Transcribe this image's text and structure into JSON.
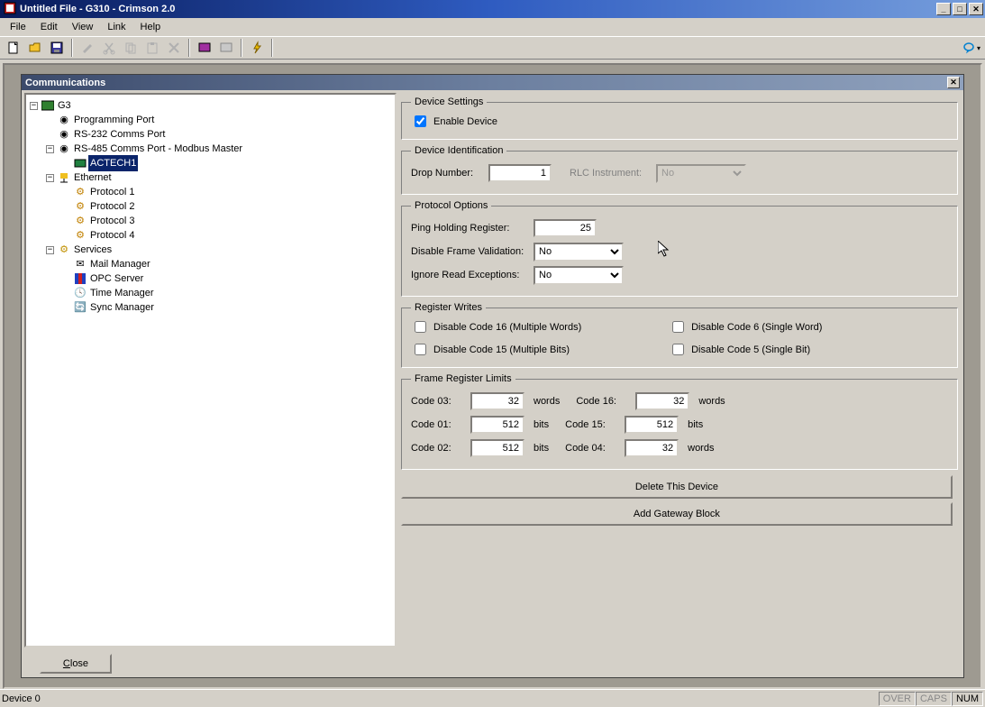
{
  "title": "Untitled File - G310 - Crimson 2.0",
  "menu": [
    "File",
    "Edit",
    "View",
    "Link",
    "Help"
  ],
  "panel_title": "Communications",
  "tree": {
    "root": "G3",
    "items": [
      "Programming Port",
      "RS-232 Comms Port",
      "RS-485 Comms Port - Modbus Master",
      "ACTECH1",
      "Ethernet",
      "Protocol 1",
      "Protocol 2",
      "Protocol 3",
      "Protocol 4",
      "Services",
      "Mail Manager",
      "OPC Server",
      "Time Manager",
      "Sync Manager"
    ]
  },
  "device_settings": {
    "legend": "Device Settings",
    "enable_label": "Enable Device",
    "enabled": true
  },
  "device_id": {
    "legend": "Device Identification",
    "drop_label": "Drop Number:",
    "drop_value": "1",
    "rlc_label": "RLC Instrument:",
    "rlc_value": "No"
  },
  "protocol_options": {
    "legend": "Protocol Options",
    "ping_label": "Ping Holding Register:",
    "ping_value": "25",
    "frame_val_label": "Disable Frame Validation:",
    "frame_val_value": "No",
    "ignore_label": "Ignore Read Exceptions:",
    "ignore_value": "No"
  },
  "register_writes": {
    "legend": "Register Writes",
    "c16": "Disable Code 16 (Multiple Words)",
    "c6": "Disable Code 6 (Single Word)",
    "c15": "Disable Code 15 (Multiple Bits)",
    "c5": "Disable Code 5 (Single Bit)"
  },
  "limits": {
    "legend": "Frame Register Limits",
    "code03_label": "Code 03:",
    "code03_value": "32",
    "code03_unit": "words",
    "code16_label": "Code 16:",
    "code16_value": "32",
    "code16_unit": "words",
    "code01_label": "Code 01:",
    "code01_value": "512",
    "code01_unit": "bits",
    "code15_label": "Code 15:",
    "code15_value": "512",
    "code15_unit": "bits",
    "code02_label": "Code 02:",
    "code02_value": "512",
    "code02_unit": "bits",
    "code04_label": "Code 04:",
    "code04_value": "32",
    "code04_unit": "words"
  },
  "buttons": {
    "delete": "Delete This Device",
    "add_gateway": "Add Gateway Block",
    "close": "Close"
  },
  "status": {
    "left": "Device 0",
    "over": "OVER",
    "caps": "CAPS",
    "num": "NUM"
  }
}
